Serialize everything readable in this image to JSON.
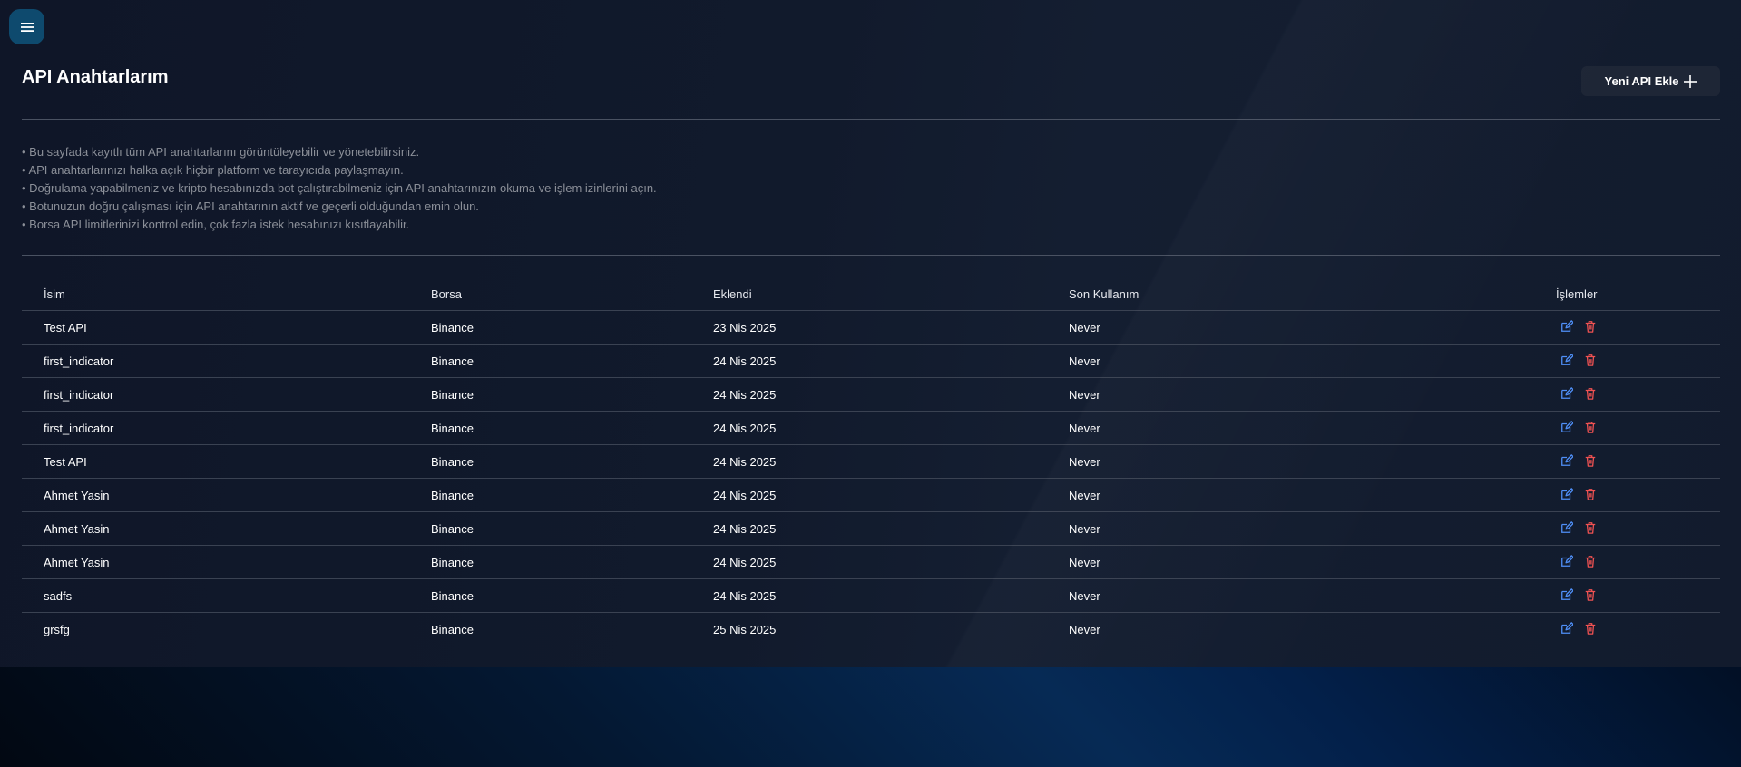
{
  "header": {
    "menu_icon": "hamburger-menu-icon",
    "title": "API Anahtarlarım",
    "add_button_label": "Yeni API Ekle",
    "add_button_icon": "plus-icon"
  },
  "info_notes": [
    "Bu sayfada kayıtlı tüm API anahtarlarını görüntüleyebilir ve yönetebilirsiniz.",
    "API anahtarlarınızı halka açık hiçbir platform ve tarayıcıda paylaşmayın.",
    "Doğrulama yapabilmeniz ve kripto hesabınızda bot çalıştırabilmeniz için API anahtarınızın okuma ve işlem izinlerini açın.",
    "Botunuzun doğru çalışması için API anahtarının aktif ve geçerli olduğundan emin olun.",
    "Borsa API limitlerinizi kontrol edin, çok fazla istek hesabınızı kısıtlayabilir."
  ],
  "table": {
    "columns": [
      "İsim",
      "Borsa",
      "Eklendi",
      "Son Kullanım",
      "İşlemler"
    ],
    "rows": [
      {
        "name": "Test API",
        "exchange": "Binance",
        "added": "23 Nis 2025",
        "last_used": "Never"
      },
      {
        "name": "first_indicator",
        "exchange": "Binance",
        "added": "24 Nis 2025",
        "last_used": "Never"
      },
      {
        "name": "first_indicator",
        "exchange": "Binance",
        "added": "24 Nis 2025",
        "last_used": "Never"
      },
      {
        "name": "first_indicator",
        "exchange": "Binance",
        "added": "24 Nis 2025",
        "last_used": "Never"
      },
      {
        "name": "Test API",
        "exchange": "Binance",
        "added": "24 Nis 2025",
        "last_used": "Never"
      },
      {
        "name": "Ahmet Yasin",
        "exchange": "Binance",
        "added": "24 Nis 2025",
        "last_used": "Never"
      },
      {
        "name": "Ahmet Yasin",
        "exchange": "Binance",
        "added": "24 Nis 2025",
        "last_used": "Never"
      },
      {
        "name": "Ahmet Yasin",
        "exchange": "Binance",
        "added": "24 Nis 2025",
        "last_used": "Never"
      },
      {
        "name": "sadfs",
        "exchange": "Binance",
        "added": "24 Nis 2025",
        "last_used": "Never"
      },
      {
        "name": "grsfg",
        "exchange": "Binance",
        "added": "25 Nis 2025",
        "last_used": "Never"
      }
    ],
    "action_icons": [
      "edit-icon",
      "trash-icon"
    ]
  },
  "colors": {
    "accent_menu": "#0e4a6e",
    "edit_icon": "#4f8ff7",
    "delete_icon": "#f05252",
    "panel_bg": "#111a2c"
  }
}
